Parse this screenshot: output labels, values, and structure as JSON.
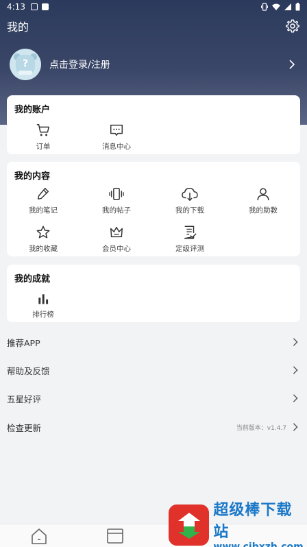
{
  "status_bar": {
    "time": "4:13"
  },
  "header": {
    "title": "我的"
  },
  "profile": {
    "login_text": "点击登录/注册"
  },
  "account_card": {
    "title": "我的账户",
    "items": [
      {
        "label": "订单",
        "icon": "cart-icon"
      },
      {
        "label": "消息中心",
        "icon": "message-icon"
      }
    ]
  },
  "content_card": {
    "title": "我的内容",
    "items": [
      {
        "label": "我的笔记",
        "icon": "pencil-icon"
      },
      {
        "label": "我的帖子",
        "icon": "vibrate-phone-icon"
      },
      {
        "label": "我的下载",
        "icon": "cloud-download-icon"
      },
      {
        "label": "我的助教",
        "icon": "person-icon"
      },
      {
        "label": "我的收藏",
        "icon": "star-icon"
      },
      {
        "label": "会员中心",
        "icon": "crown-icon"
      },
      {
        "label": "定级评测",
        "icon": "checklist-icon"
      }
    ]
  },
  "achievement_card": {
    "title": "我的成就",
    "items": [
      {
        "label": "排行榜",
        "icon": "bar-chart-icon"
      }
    ]
  },
  "menu": [
    {
      "label": "推荐APP"
    },
    {
      "label": "帮助及反馈"
    },
    {
      "label": "五星好评"
    },
    {
      "label": "检查更新",
      "note": "当前版本：v1.4.7"
    }
  ],
  "watermark": {
    "title": "超级棒下载站",
    "url": "www.cjbxzh.com"
  }
}
